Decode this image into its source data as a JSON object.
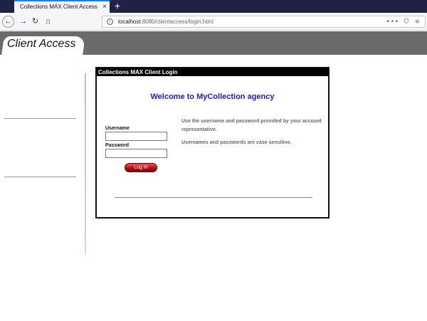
{
  "browser": {
    "tab_title": "Collections MAX Client Access",
    "tab_close": "×",
    "new_tab": "+",
    "url_host": "localhost",
    "url_rest": ":8080/clientaccess/login.html",
    "back": "←",
    "forward": "→",
    "reload": "↻",
    "home": "⌂",
    "info": "i",
    "tools": "••• ⛉ ☆"
  },
  "header": {
    "brand": "Client Access"
  },
  "panel": {
    "title": "Collections MAX Client Login",
    "welcome": "Welcome to MyCollection agency",
    "username_label": "Username",
    "password_label": "Password",
    "username_value": "",
    "password_value": "",
    "login_button": "Log In",
    "help_text_1": "Use the username and password provided by your account representative.",
    "help_text_2": "Usernames and passwords are case sensitive."
  }
}
